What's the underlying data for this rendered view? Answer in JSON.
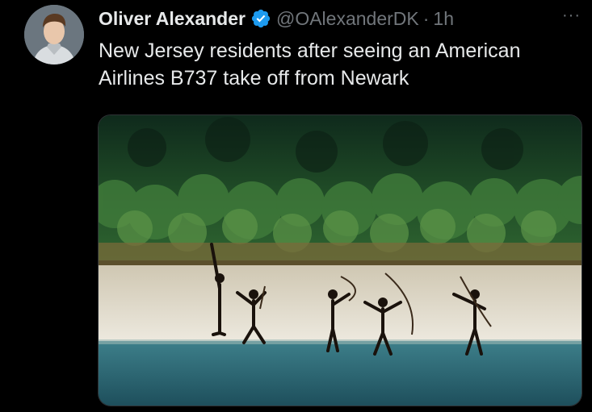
{
  "tweet": {
    "author_name": "Oliver Alexander",
    "handle": "@OAlexanderDK",
    "separator": "·",
    "time": "1h",
    "more": "···",
    "text": "New Jersey residents after seeing an American Airlines B737 take off from Newark"
  },
  "icons": {
    "verified": "verified-badge-icon",
    "more": "more-icon"
  },
  "colors": {
    "background": "#000000",
    "text": "#e7e9ea",
    "secondary": "#71767b",
    "verified": "#1d9bf0"
  }
}
